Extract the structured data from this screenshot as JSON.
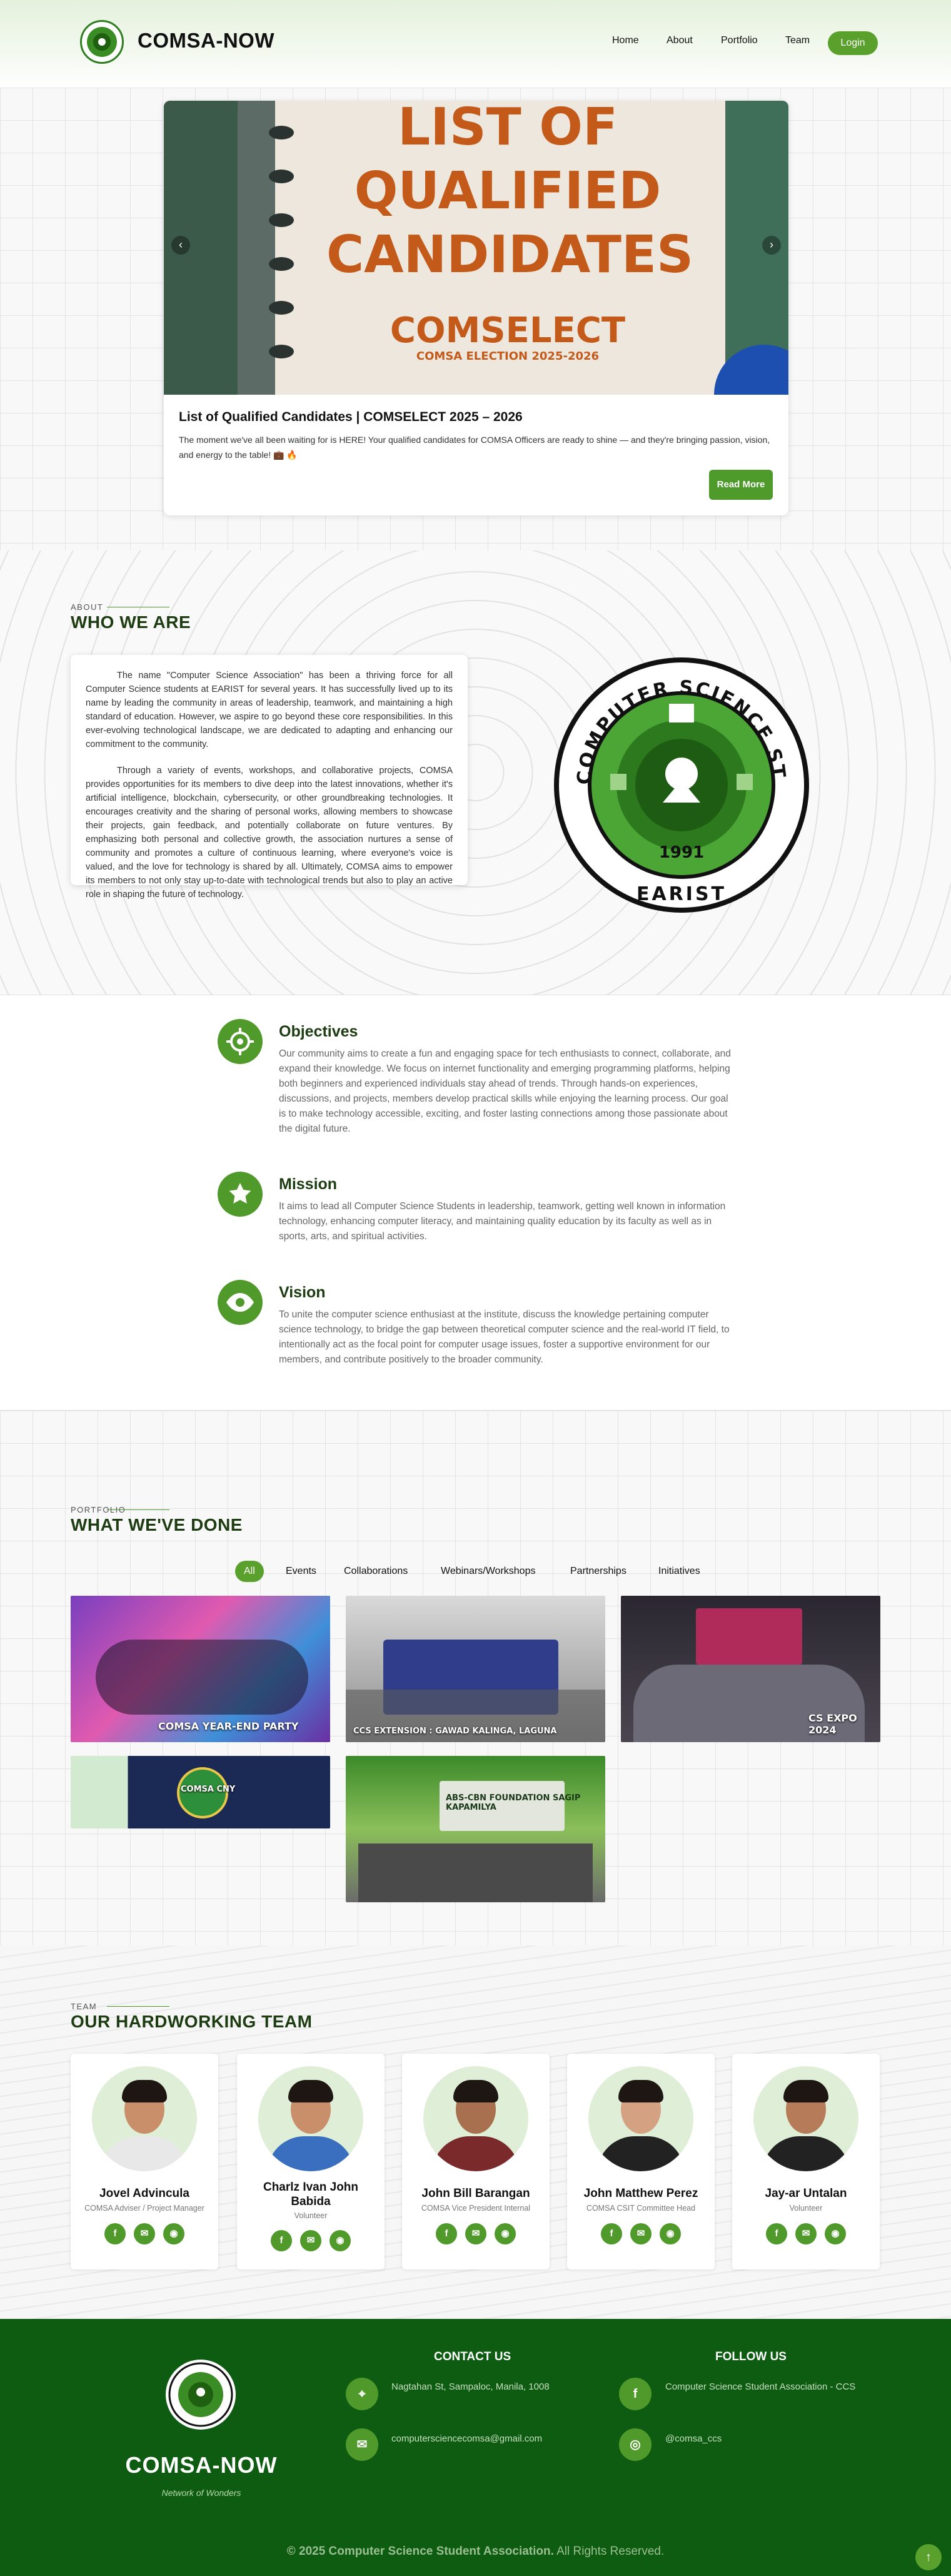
{
  "header": {
    "brand": "COMSA-NOW",
    "nav": [
      "Home",
      "About",
      "Portfolio",
      "Team"
    ],
    "login_label": "Login"
  },
  "hero": {
    "image_lines": [
      "LIST OF",
      "QUALIFIED",
      "CANDIDATES",
      "COMSELECT",
      "COMSA ELECTION 2025-2026"
    ],
    "title": "List of Qualified Candidates | COMSELECT 2025 – 2026",
    "text": "The moment we've all been waiting for is HERE! Your qualified candidates for COMSA Officers are ready to shine — and they're bringing passion, vision, and energy to the table! 💼 🔥",
    "read_more": "Read More",
    "prev": "‹",
    "next": "›"
  },
  "about": {
    "label": "ABOUT",
    "heading": "WHO WE ARE",
    "p1": "The name \"Computer Science Association\" has been a thriving force for all Computer Science students at EARIST for several years. It has successfully lived up to its name by leading the community in areas of leadership, teamwork, and maintaining a high standard of education. However, we aspire to go beyond these core responsibilities. In this ever-evolving technological landscape, we are dedicated to adapting and enhancing our commitment to the community.",
    "p2": "Through a variety of events, workshops, and collaborative projects, COMSA provides opportunities for its members to dive deep into the latest innovations, whether it's artificial intelligence, blockchain, cybersecurity, or other groundbreaking technologies. It encourages creativity and the sharing of personal works, allowing members to showcase their projects, gain feedback, and potentially collaborate on future ventures. By emphasizing both personal and collective growth, the association nurtures a sense of community and promotes a culture of continuous learning, where everyone's voice is valued, and the love for technology is shared by all. Ultimately, COMSA aims to empower its members to not only stay up-to-date with technological trends but also to play an active role in shaping the future of technology.",
    "seal_top": "COMPUTER SCIENCE STUDENT ASSOCIATION",
    "seal_year": "1991",
    "seal_bottom": "EARIST"
  },
  "omv": [
    {
      "title": "Objectives",
      "text": "Our community aims to create a fun and engaging space for tech enthusiasts to connect, collaborate, and expand their knowledge. We focus on internet functionality and emerging programming platforms, helping both beginners and experienced individuals stay ahead of trends. Through hands-on experiences, discussions, and projects, members develop practical skills while enjoying the learning process. Our goal is to make technology accessible, exciting, and foster lasting connections among those passionate about the digital future."
    },
    {
      "title": "Mission",
      "text": "It aims to lead all Computer Science Students in leadership, teamwork, getting well known in information technology, enhancing computer literacy, and maintaining quality education by its faculty as well as in sports, arts, and spiritual activities."
    },
    {
      "title": "Vision",
      "text": "To unite the computer science enthusiast at the institute, discuss the knowledge pertaining computer science technology, to bridge the gap between theoretical computer science and the real-world IT field, to intentionally act as the focal point for computer usage issues, foster a supportive environment for our members, and contribute positively to the broader community."
    }
  ],
  "portfolio": {
    "label": "PORTFOLIO",
    "heading": "WHAT WE'VE DONE",
    "filters": [
      "All",
      "Events",
      "Collaborations",
      "Webinars/Workshops",
      "Partnerships",
      "Initiatives"
    ],
    "captions": [
      "COMSA YEAR-END PARTY",
      "CCS EXTENSION : GAWAD KALINGA, LAGUNA",
      "CS EXPO 2024",
      "COMSA CNY",
      "ABS-CBN FOUNDATION SAGIP KAPAMILYA"
    ]
  },
  "team": {
    "label": "TEAM",
    "heading": "OUR HARDWORKING TEAM",
    "members": [
      {
        "name": "Jovel Advincula",
        "role": "COMSA Adviser / Project Manager"
      },
      {
        "name": "Charlz Ivan John Babida",
        "role": "Volunteer"
      },
      {
        "name": "John Bill Barangan",
        "role": "COMSA Vice President Internal"
      },
      {
        "name": "John Matthew Perez",
        "role": "COMSA CSIT Committee Head"
      },
      {
        "name": "Jay-ar Untalan",
        "role": "Volunteer"
      }
    ]
  },
  "footer": {
    "brand": "COMSA-NOW",
    "tagline": "Network of Wonders",
    "contact_heading": "CONTACT US",
    "follow_heading": "FOLLOW US",
    "address": "Nagtahan St, Sampaloc, Manila, 1008",
    "email": "computersciencecomsa@gmail.com",
    "facebook": "Computer Science Student Association - CCS",
    "instagram": "@comsa_ccs",
    "copyright_bold": "© 2025 Computer Science Student Association.",
    "copyright_rest": " All Rights Reserved."
  },
  "colors": {
    "accent": "#4f9a2a",
    "dark_green": "#0d5c12",
    "heading": "#1d3c12"
  },
  "icons": [
    "target-icon",
    "star-icon",
    "eye-icon",
    "facebook-icon",
    "mail-icon",
    "github-icon",
    "location-icon",
    "instagram-icon",
    "arrow-up-icon"
  ]
}
